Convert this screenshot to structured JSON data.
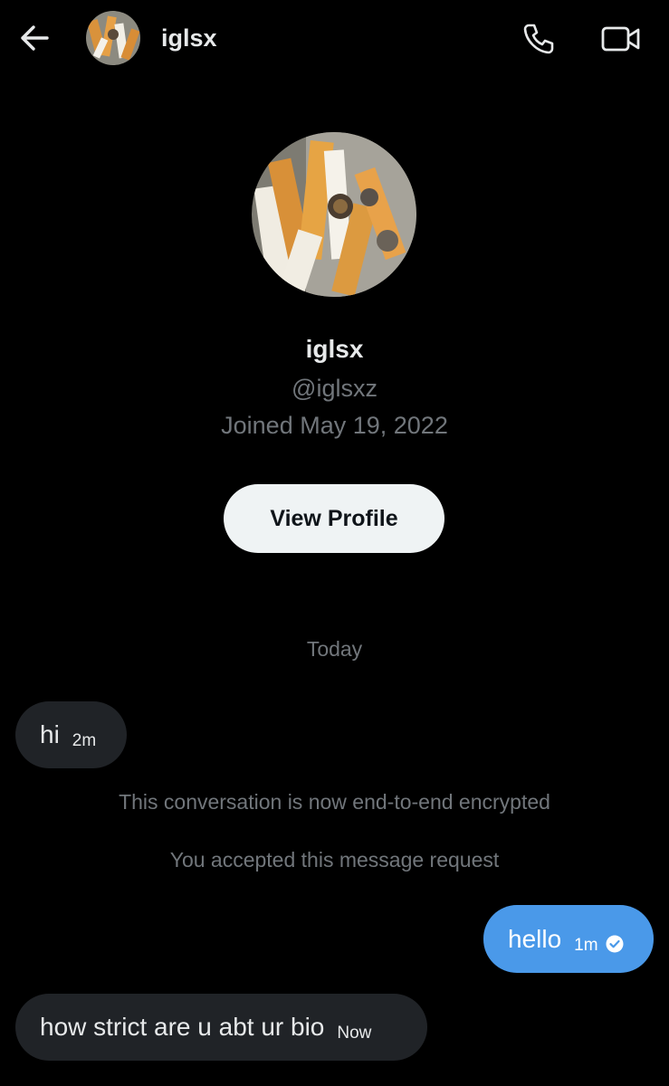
{
  "header": {
    "name": "iglsx",
    "icons": {
      "back": "arrow-left-icon",
      "call": "phone-icon",
      "video": "video-camera-icon"
    }
  },
  "profile": {
    "name": "iglsx",
    "handle": "@iglsxz",
    "joined": "Joined May 19, 2022",
    "view_profile_label": "View Profile"
  },
  "conversation": {
    "day_separator": "Today",
    "messages": [
      {
        "direction": "incoming",
        "text": "hi",
        "time": "2m"
      },
      {
        "direction": "outgoing",
        "text": "hello",
        "time": "1m",
        "status_icon": "read-check-icon"
      },
      {
        "direction": "incoming",
        "text": "how strict are u abt ur bio",
        "time": "Now"
      }
    ],
    "system_messages": [
      "This conversation is now end-to-end encrypted",
      "You accepted this message request"
    ]
  },
  "colors": {
    "background": "#000000",
    "incoming_bubble": "#202327",
    "outgoing_bubble": "#4a99e9",
    "muted_text": "#71767b",
    "button_bg": "#eff3f4"
  }
}
